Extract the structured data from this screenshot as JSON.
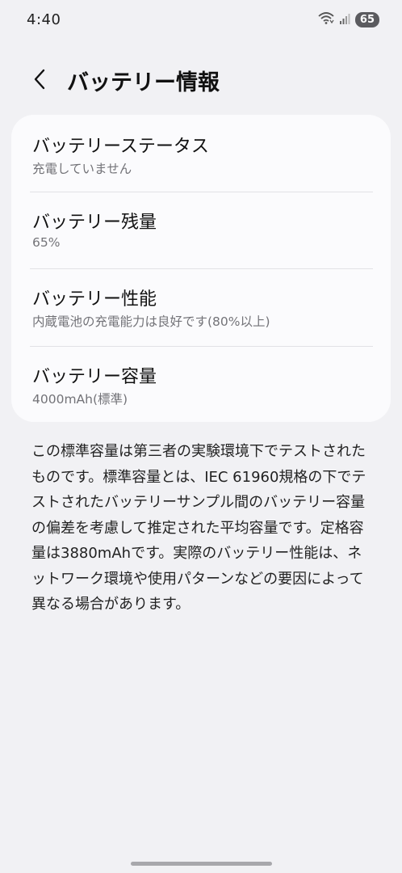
{
  "status_bar": {
    "time": "4:40",
    "battery_level": "65",
    "icons": [
      "wifi-icon",
      "signal-icon"
    ]
  },
  "header": {
    "title": "バッテリー情報",
    "back_icon": "chevron-left-icon"
  },
  "items": [
    {
      "title": "バッテリーステータス",
      "subtitle": "充電していません"
    },
    {
      "title": "バッテリー残量",
      "subtitle": "65%"
    },
    {
      "title": "バッテリー性能",
      "subtitle": "内蔵電池の充電能力は良好です(80%以上)"
    },
    {
      "title": "バッテリー容量",
      "subtitle": "4000mAh(標準)"
    }
  ],
  "description": "この標準容量は第三者の実験環境下でテストされたものです。標準容量とは、IEC 61960規格の下でテストされたバッテリーサンプル間のバッテリー容量の偏差を考慮して推定された平均容量です。定格容量は3880mAhです。実際のバッテリー性能は、ネットワーク環境や使用パターンなどの要因によって異なる場合があります。"
}
